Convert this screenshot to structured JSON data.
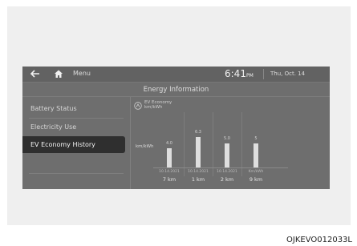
{
  "topbar": {
    "menu_label": "Menu",
    "time": "6:41",
    "time_suffix": "PM",
    "date": "Thu, Oct. 14"
  },
  "page_title": "Energy Information",
  "menu": {
    "items": [
      {
        "label": "Battery Status"
      },
      {
        "label": "Electricity Use"
      },
      {
        "label": "EV Economy History"
      }
    ],
    "selected_index": 2
  },
  "legend": {
    "icon": "ev-economy-icon",
    "line1": "EV Economy",
    "line2": "km/kWh"
  },
  "chart_data": {
    "type": "bar",
    "ylabel": "km/kWh",
    "categories": [
      "10.14.2021",
      "10.14.2021",
      "10.14.2021",
      "Km/kWh"
    ],
    "values": [
      4.0,
      6.3,
      5.0,
      5.0
    ],
    "value_labels": [
      "4.0",
      "6.3",
      "5.0",
      "5"
    ],
    "distances": [
      "7 km",
      "1 km",
      "2 km",
      "9 km"
    ]
  },
  "caption": "OJKEVO012033L"
}
